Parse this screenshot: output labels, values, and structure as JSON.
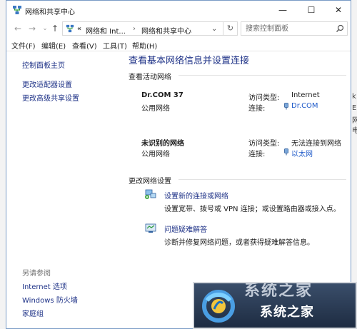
{
  "window": {
    "title": "网络和共享中心"
  },
  "address_bar": {
    "chevron": "«",
    "crumbs": [
      "网络和 Int...",
      "网络和共享中心"
    ],
    "search_placeholder": "搜索控制面板"
  },
  "menu": [
    "文件(F)",
    "编辑(E)",
    "查看(V)",
    "工具(T)",
    "帮助(H)"
  ],
  "sidebar": {
    "links": [
      "控制面板主页",
      "更改适配器设置",
      "更改高级共享设置"
    ],
    "see_also_title": "另请参阅",
    "see_also": [
      "Internet 选项",
      "Windows 防火墙",
      "家庭组"
    ]
  },
  "main": {
    "heading": "查看基本网络信息并设置连接",
    "active_title": "查看活动网络",
    "networks": [
      {
        "name": "Dr.COM  37",
        "category": "公用网络",
        "access_label": "访问类型:",
        "access_value": "Internet",
        "conn_label": "连接:",
        "conn_value": "Dr.COM"
      },
      {
        "name": "未识别的网络",
        "category": "公用网络",
        "access_label": "访问类型:",
        "access_value": "无法连接到网络",
        "conn_label": "连接:",
        "conn_value": "以太网"
      }
    ],
    "change_title": "更改网络设置",
    "tasks": [
      {
        "link": "设置新的连接或网络",
        "desc": "设置宽带、拨号或 VPN 连接；或设置路由器或接入点。"
      },
      {
        "link": "问题疑难解答",
        "desc": "诊断并修复网络问题，或者获得疑难解答信息。"
      }
    ]
  },
  "watermark": {
    "top_text": "系统之家",
    "name": "系统之家"
  },
  "right_edge": [
    "k",
    "E",
    "网",
    "电"
  ],
  "colors": {
    "link": "#1e3287",
    "link_alt": "#1d59c9",
    "border": "#7a9cc6"
  }
}
